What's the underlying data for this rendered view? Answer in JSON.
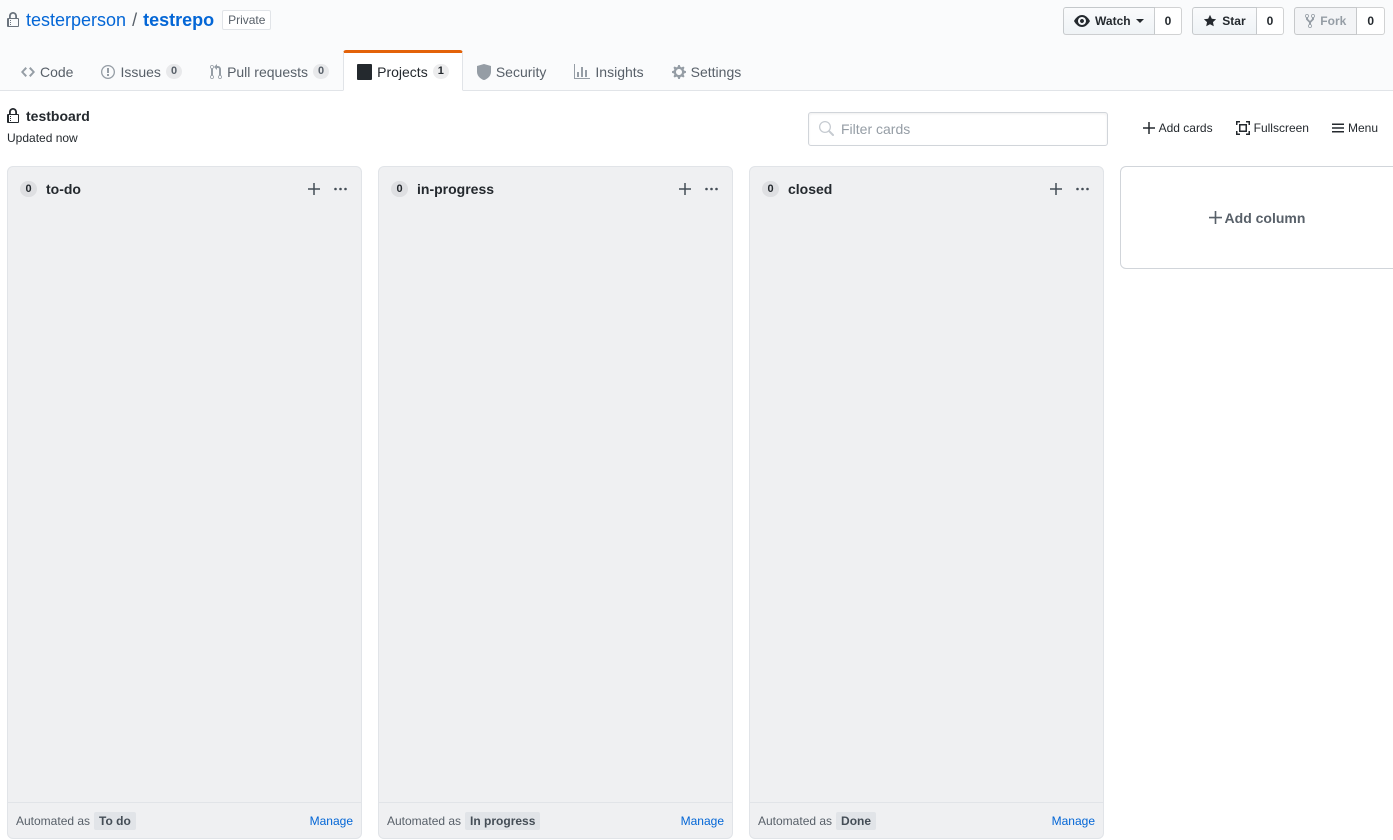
{
  "repo": {
    "owner": "testerperson",
    "separator": "/",
    "name": "testrepo",
    "visibility": "Private"
  },
  "actions": {
    "watch": {
      "label": "Watch",
      "count": "0"
    },
    "star": {
      "label": "Star",
      "count": "0"
    },
    "fork": {
      "label": "Fork",
      "count": "0"
    }
  },
  "nav": {
    "tabs": [
      {
        "label": "Code",
        "icon": "code-icon"
      },
      {
        "label": "Issues",
        "icon": "issue-icon",
        "counter": "0"
      },
      {
        "label": "Pull requests",
        "icon": "pull-request-icon",
        "counter": "0"
      },
      {
        "label": "Projects",
        "icon": "project-icon",
        "counter": "1",
        "selected": true
      },
      {
        "label": "Security",
        "icon": "shield-icon"
      },
      {
        "label": "Insights",
        "icon": "graph-icon"
      },
      {
        "label": "Settings",
        "icon": "gear-icon"
      }
    ]
  },
  "project": {
    "name": "testboard",
    "updated": "Updated now",
    "filter_placeholder": "Filter cards",
    "add_cards": "Add cards",
    "fullscreen": "Fullscreen",
    "menu": "Menu"
  },
  "columns": [
    {
      "count": "0",
      "name": "to-do",
      "automated_as": "Automated as",
      "preset": "To do",
      "manage": "Manage"
    },
    {
      "count": "0",
      "name": "in-progress",
      "automated_as": "Automated as",
      "preset": "In progress",
      "manage": "Manage"
    },
    {
      "count": "0",
      "name": "closed",
      "automated_as": "Automated as",
      "preset": "Done",
      "manage": "Manage"
    }
  ],
  "add_column": "Add column",
  "colors": {
    "link": "#0366d6",
    "selected_tab_accent": "#e36209",
    "column_bg": "#eff0f2"
  }
}
